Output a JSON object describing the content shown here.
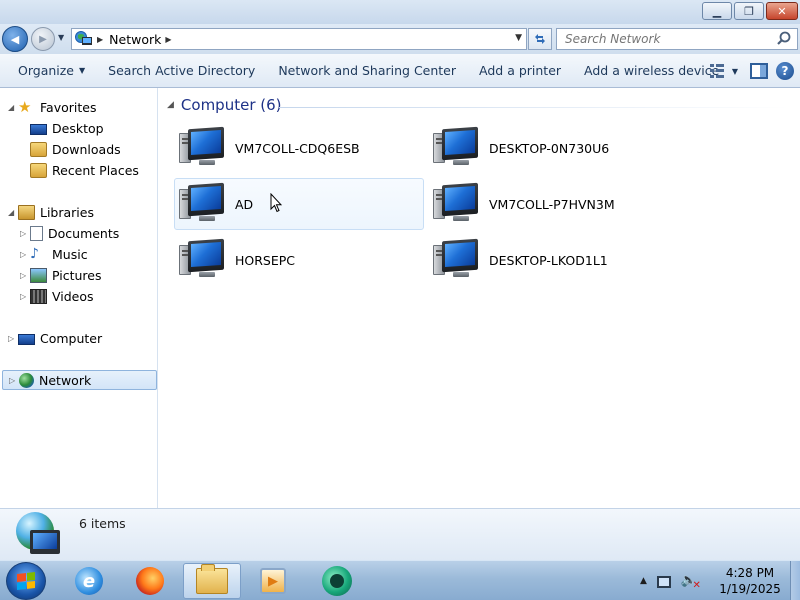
{
  "window": {
    "minimize_glyph": "▁",
    "maximize_glyph": "❐",
    "close_glyph": "✕"
  },
  "navigation": {
    "back_glyph": "◀",
    "forward_glyph": "▶",
    "address": {
      "breadcrumb": [
        "Network"
      ],
      "location_icon": "network-icon"
    },
    "refresh_icon": "refresh-icon",
    "search": {
      "placeholder": "Search Network",
      "value": ""
    }
  },
  "command_bar": {
    "organize": "Organize",
    "search_ad": "Search Active Directory",
    "network_sharing": "Network and Sharing Center",
    "add_printer": "Add a printer",
    "add_wireless": "Add a wireless device"
  },
  "nav_pane": {
    "favorites": {
      "label": "Favorites",
      "items": [
        "Desktop",
        "Downloads",
        "Recent Places"
      ]
    },
    "libraries": {
      "label": "Libraries",
      "items": [
        "Documents",
        "Music",
        "Pictures",
        "Videos"
      ]
    },
    "computer": "Computer",
    "network": "Network"
  },
  "content": {
    "group_header": "Computer (6)",
    "computers": [
      "VM7COLL-CDQ6ESB",
      "DESKTOP-0N730U6",
      "AD",
      "VM7COLL-P7HVN3M",
      "HORSEPC",
      "DESKTOP-LKOD1L1"
    ]
  },
  "details": {
    "item_count": "6 items"
  },
  "taskbar": {
    "apps": [
      "internet-explorer-icon",
      "firefox-icon",
      "windows-explorer-icon",
      "media-player-icon",
      "green-app-icon"
    ],
    "clock_time": "4:28 PM",
    "clock_date": "1/19/2025"
  }
}
